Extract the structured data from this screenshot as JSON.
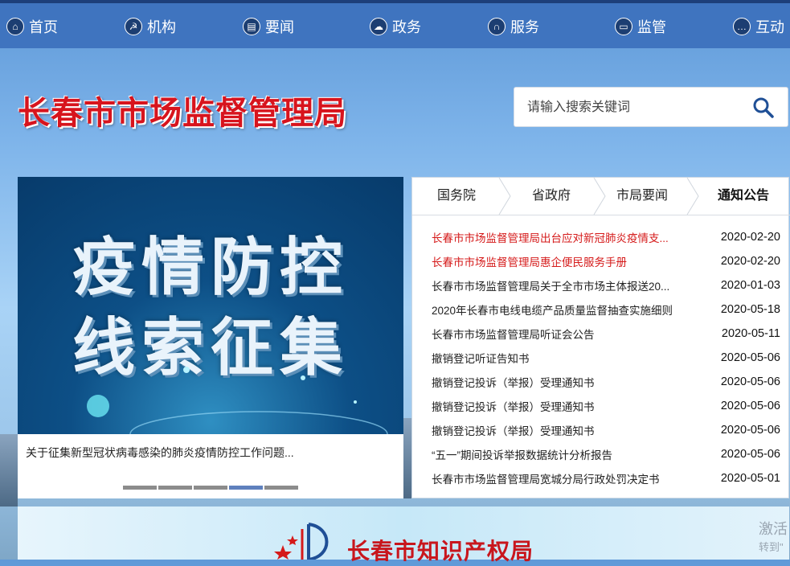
{
  "nav": {
    "items": [
      {
        "label": "首页",
        "icon": "home-icon"
      },
      {
        "label": "机构",
        "icon": "party-emblem-icon"
      },
      {
        "label": "要闻",
        "icon": "document-icon"
      },
      {
        "label": "政务",
        "icon": "cloud-upload-icon"
      },
      {
        "label": "服务",
        "icon": "headset-icon"
      },
      {
        "label": "监管",
        "icon": "monitor-icon"
      },
      {
        "label": "互动",
        "icon": "chat-bubbles-icon"
      }
    ]
  },
  "header": {
    "title": "长春市市场监督管理局",
    "search_placeholder": "请输入搜索关键词"
  },
  "banner": {
    "line1": "疫情防控",
    "line2": "线索征集",
    "caption": "关于征集新型冠状病毒感染的肺炎疫情防控工作问题...",
    "slide_count": 5,
    "active_slide": 4
  },
  "news": {
    "tabs": [
      "国务院",
      "省政府",
      "市局要闻",
      "通知公告"
    ],
    "active_tab": 3,
    "items": [
      {
        "title": "长春市市场监督管理局出台应对新冠肺炎疫情支...",
        "date": "2020-02-20",
        "highlight": true
      },
      {
        "title": "长春市市场监督管理局惠企便民服务手册",
        "date": "2020-02-20",
        "highlight": true
      },
      {
        "title": "长春市市场监督管理局关于全市市场主体报送20...",
        "date": "2020-01-03",
        "highlight": false
      },
      {
        "title": "2020年长春市电线电缆产品质量监督抽查实施细则",
        "date": "2020-05-18",
        "highlight": false
      },
      {
        "title": "长春市市场监督管理局听证会公告",
        "date": "2020-05-11",
        "highlight": false
      },
      {
        "title": "撤销登记听证告知书",
        "date": "2020-05-06",
        "highlight": false
      },
      {
        "title": "撤销登记投诉（举报）受理通知书",
        "date": "2020-05-06",
        "highlight": false
      },
      {
        "title": "撤销登记投诉（举报）受理通知书",
        "date": "2020-05-06",
        "highlight": false
      },
      {
        "title": "撤销登记投诉（举报）受理通知书",
        "date": "2020-05-06",
        "highlight": false
      },
      {
        "title": "“五一”期间投诉举报数据统计分析报告",
        "date": "2020-05-06",
        "highlight": false
      },
      {
        "title": "长春市市场监督管理局宽城分局行政处罚决定书",
        "date": "2020-05-01",
        "highlight": false
      }
    ]
  },
  "bottom_banner": {
    "title": "长春市知识产权局"
  },
  "watermark": {
    "line1": "激活",
    "line2": "转到\""
  },
  "colors": {
    "nav_bar": "#3f74bf",
    "title_red": "#d7141d",
    "highlight_red": "#d51a1a",
    "active_dot": "#5f80bd"
  }
}
